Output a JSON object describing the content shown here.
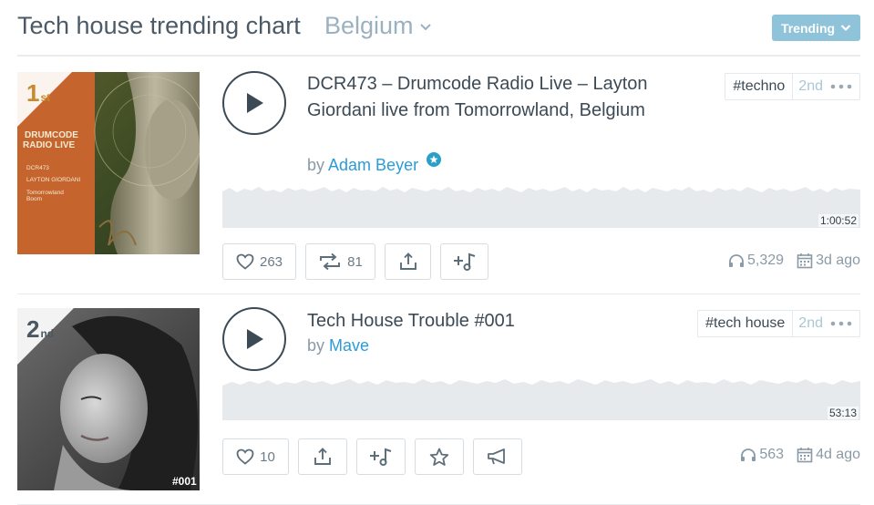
{
  "header": {
    "title": "Tech house trending chart",
    "country": "Belgium",
    "trending_label": "Trending"
  },
  "colors": {
    "accent": "#2b9cd8",
    "trending_button": "#8fc3d9",
    "rank_gold": "#c98a2b"
  },
  "tracks": [
    {
      "rank_num": "1",
      "rank_suffix": "st",
      "title": "DCR473 – Drumcode Radio Live – Layton Giordani live from Tomorrowland, Belgium",
      "by_prefix": "by",
      "artist": "Adam Beyer",
      "artist_verified": true,
      "tag": "#techno",
      "tag_rank": "2nd",
      "duration": "1:00:52",
      "likes": "263",
      "reposts": "81",
      "plays": "5,329",
      "age": "3d ago",
      "cover_text": [
        "DRUMCODE",
        "RADIO LIVE",
        "DCR473",
        "LAYTON GIORDANI",
        "Tomorrowland",
        "Boom"
      ]
    },
    {
      "rank_num": "2",
      "rank_suffix": "nd",
      "title": "Tech House Trouble #001",
      "by_prefix": "by",
      "artist": "Mave",
      "tag": "#tech house",
      "tag_rank": "2nd",
      "duration": "53:13",
      "likes": "10",
      "plays": "563",
      "age": "4d ago",
      "cover_text": [
        "#001"
      ]
    }
  ]
}
